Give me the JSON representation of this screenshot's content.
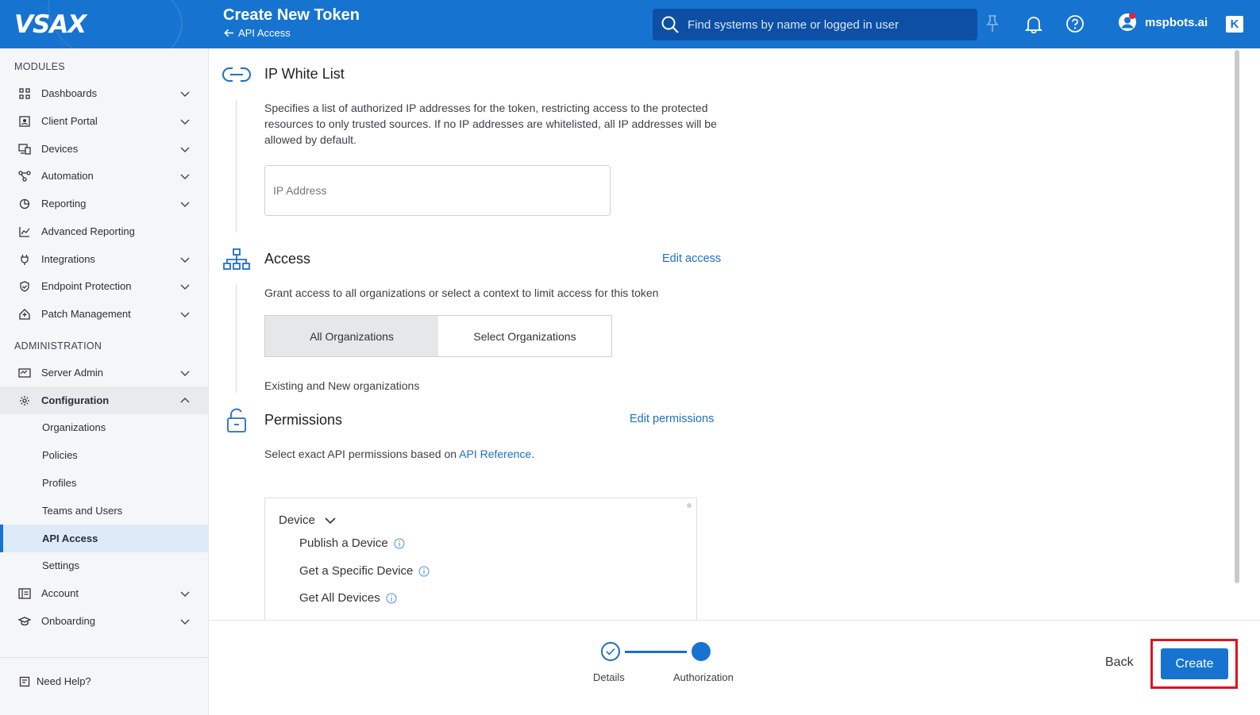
{
  "header": {
    "logo": "VSAX",
    "title": "Create New Token",
    "back_label": "API Access",
    "search_placeholder": "Find systems by name or logged in user",
    "username": "mspbots.ai",
    "kaseya_logo": "K"
  },
  "sidebar": {
    "modules_label": "MODULES",
    "modules": [
      {
        "label": "Dashboards",
        "icon": "grid-icon"
      },
      {
        "label": "Client Portal",
        "icon": "portal-icon"
      },
      {
        "label": "Devices",
        "icon": "devices-icon"
      },
      {
        "label": "Automation",
        "icon": "automation-icon"
      },
      {
        "label": "Reporting",
        "icon": "pie-chart-icon"
      },
      {
        "label": "Advanced Reporting",
        "icon": "line-chart-icon"
      },
      {
        "label": "Integrations",
        "icon": "plug-icon"
      },
      {
        "label": "Endpoint Protection",
        "icon": "shield-icon"
      },
      {
        "label": "Patch Management",
        "icon": "patch-icon"
      }
    ],
    "admin_label": "ADMINISTRATION",
    "admin": [
      {
        "label": "Server Admin",
        "icon": "server-icon"
      },
      {
        "label": "Configuration",
        "icon": "gear-icon"
      }
    ],
    "config_sub": [
      "Organizations",
      "Policies",
      "Profiles",
      "Teams and Users",
      "API Access",
      "Settings"
    ],
    "after": [
      {
        "label": "Account",
        "icon": "account-icon"
      },
      {
        "label": "Onboarding",
        "icon": "graduation-icon"
      }
    ],
    "need_help": "Need Help?"
  },
  "ip_whitelist": {
    "title": "IP White List",
    "description": "Specifies a list of authorized IP addresses for the token, restricting access to the protected resources to only trusted sources. If no IP addresses are whitelisted, all IP addresses will be allowed by default.",
    "input_placeholder": "IP Address"
  },
  "access": {
    "title": "Access",
    "edit_label": "Edit access",
    "description": "Grant access to all organizations or select a context to limit access for this token",
    "options": [
      "All Organizations",
      "Select Organizations"
    ],
    "selected": "All Organizations",
    "note": "Existing and New organizations"
  },
  "permissions": {
    "title": "Permissions",
    "edit_label": "Edit permissions",
    "description_prefix": "Select exact API permissions based on ",
    "link_label": "API Reference",
    "description_suffix": ".",
    "group": "Device",
    "items": [
      "Publish a Device",
      "Get a Specific Device",
      "Get All Devices"
    ]
  },
  "wizard": {
    "steps": [
      "Details",
      "Authorization"
    ],
    "back_label": "Back",
    "create_label": "Create"
  },
  "colors": {
    "brand": "#1674d0",
    "link": "#1f6ec5",
    "highlight": "#d9161f"
  }
}
